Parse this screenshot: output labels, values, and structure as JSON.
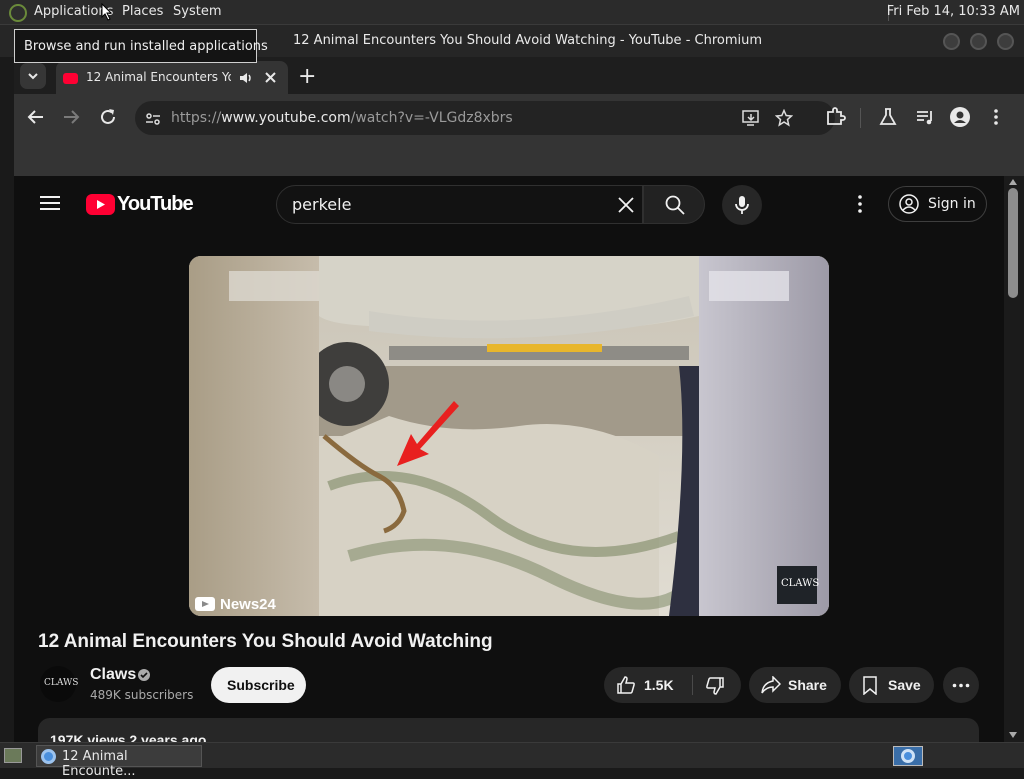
{
  "top_panel": {
    "menus": [
      "Applications",
      "Places",
      "System"
    ],
    "clock": "Fri Feb 14, 10:33 AM"
  },
  "tooltip": "Browse and run installed applications",
  "window": {
    "title": "12 Animal Encounters You Should Avoid Watching - YouTube - Chromium"
  },
  "tab": {
    "label": "12 Animal Encounters You Should Avoid Watching",
    "new_tab": "+"
  },
  "toolbar": {
    "url_prefix": "https://",
    "url_domain": "www.youtube.com",
    "url_path": "/watch?v=-VLGdz8xbrs"
  },
  "youtube": {
    "logo_text": "YouTube",
    "search_query": "perkele",
    "sign_in_label": "Sign in",
    "video": {
      "watermark": "News24",
      "channel_watermark": "CLAWS"
    },
    "title": "12 Animal Encounters You Should Avoid Watching",
    "channel": {
      "name": "Claws",
      "subscribers": "489K subscribers",
      "avatar_text": "CLAWS"
    },
    "subscribe_label": "Subscribe",
    "likes": "1.5K",
    "share_label": "Share",
    "save_label": "Save",
    "description_meta": "197K views  2 years ago"
  },
  "taskbar": {
    "item_label": "12 Animal Encounte..."
  },
  "colors": {
    "youtube_red": "#ff0033",
    "page_bg": "#0f0f0f",
    "arrow_red": "#e8201f"
  }
}
